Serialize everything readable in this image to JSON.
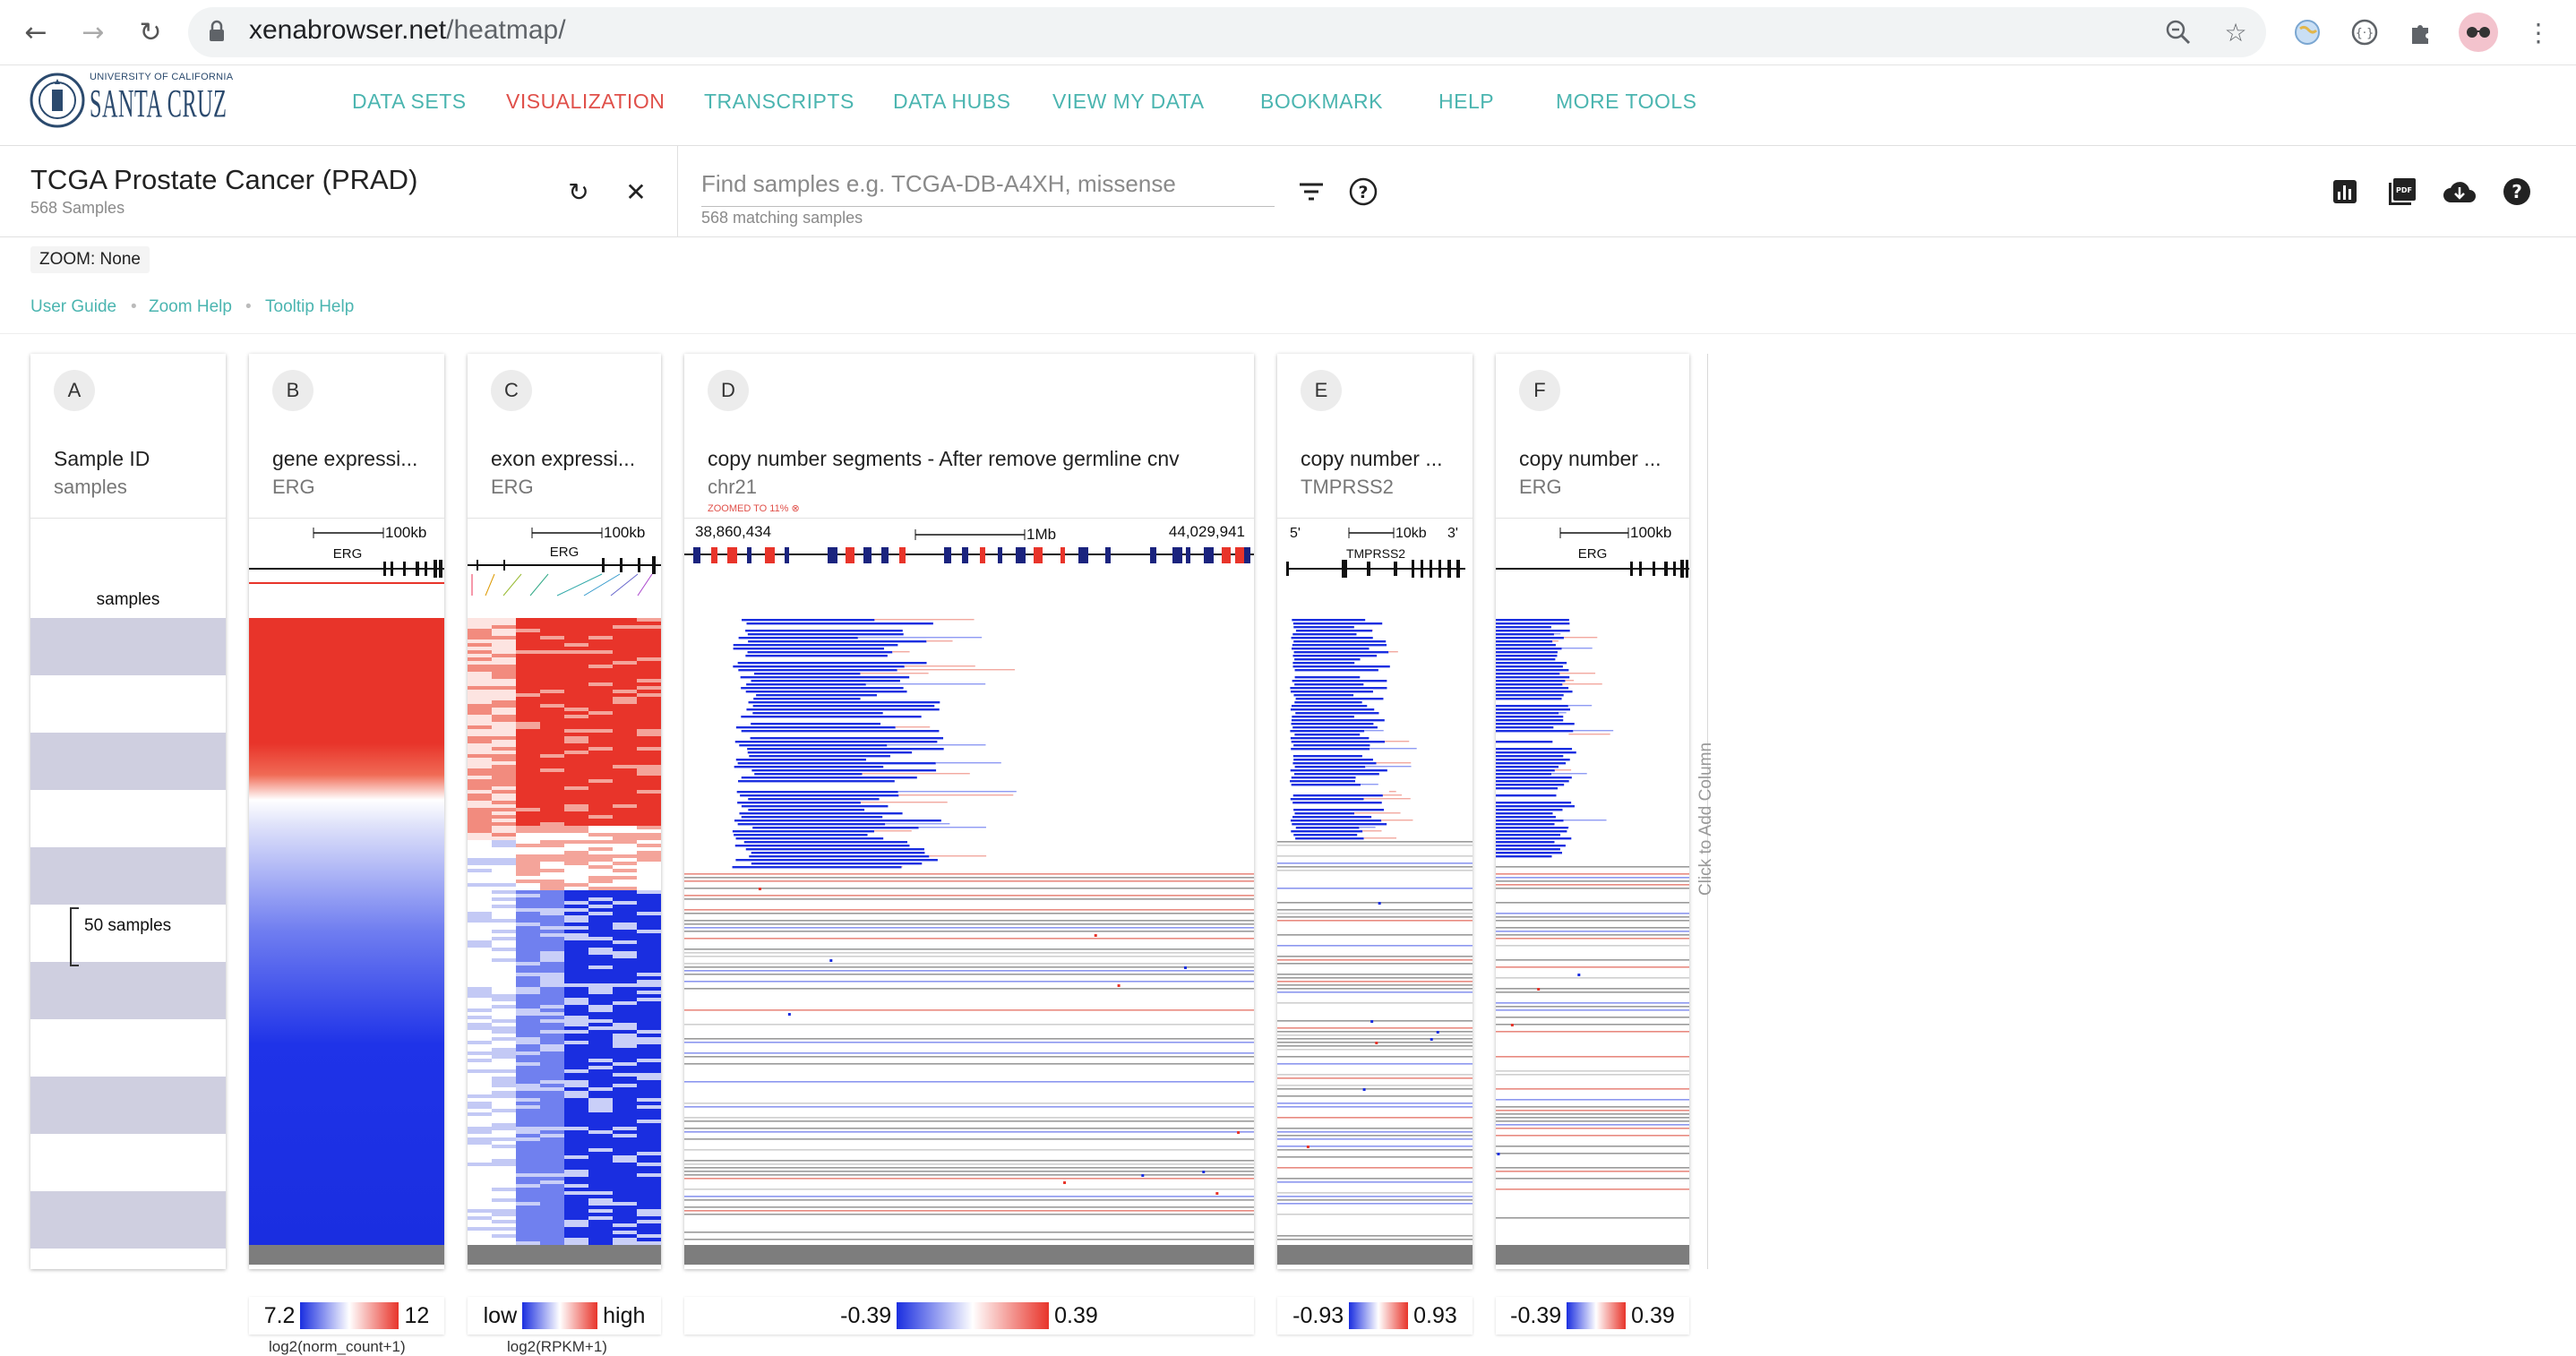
{
  "browser": {
    "url_host": "xenabrowser.net",
    "url_path": "/heatmap/",
    "icons": [
      "back-icon",
      "forward-icon",
      "reload-icon",
      "lock-icon",
      "zoom-icon",
      "star-icon",
      "extension-icon",
      "profile-avatar-icon",
      "menu-icon"
    ]
  },
  "site": {
    "logo_top": "UNIVERSITY OF CALIFORNIA",
    "logo_main": "SANTA CRUZ",
    "nav": [
      "DATA SETS",
      "VISUALIZATION",
      "TRANSCRIPTS",
      "DATA HUBS",
      "VIEW MY DATA",
      "BOOKMARK",
      "HELP",
      "MORE TOOLS"
    ],
    "active_nav": "VISUALIZATION",
    "accent": "#4bb5b0",
    "active_color": "#e0504a"
  },
  "cohort": {
    "title": "TCGA Prostate Cancer (PRAD)",
    "count": "568 Samples"
  },
  "search": {
    "placeholder": "Find samples e.g. TCGA-DB-A4XH, missense",
    "matching": "568 matching samples"
  },
  "zoom": "ZOOM: None",
  "help_links": [
    "User Guide",
    "Zoom Help",
    "Tooltip Help"
  ],
  "columns": [
    {
      "letter": "A",
      "title": "Sample ID",
      "subtitle": "samples",
      "axis_label": "samples",
      "bracket_label": "50 samples"
    },
    {
      "letter": "B",
      "title": "gene expressi...",
      "subtitle": "ERG",
      "scale": "100kb",
      "gene": "ERG"
    },
    {
      "letter": "C",
      "title": "exon expressi...",
      "subtitle": "ERG",
      "scale": "100kb",
      "gene": "ERG"
    },
    {
      "letter": "D",
      "title": "copy number segments - After remove germline cnv",
      "subtitle": "chr21",
      "zoom_note": "ZOOMED TO 11%",
      "pos_start": "38,860,434",
      "pos_end": "44,029,941",
      "scale": "1Mb"
    },
    {
      "letter": "E",
      "title": "copy number ...",
      "subtitle": "TMPRSS2",
      "scale": "10kb",
      "gene": "TMPRSS2",
      "five_prime": "5'",
      "three_prime": "3'"
    },
    {
      "letter": "F",
      "title": "copy number ...",
      "subtitle": "ERG",
      "scale": "100kb",
      "gene": "ERG"
    }
  ],
  "legends": [
    {
      "min": "7.2",
      "max": "12",
      "caption": "log2(norm_count+1)"
    },
    {
      "min": "low",
      "max": "high",
      "caption": "log2(RPKM+1)"
    },
    {
      "min": "-0.39",
      "max": "0.39"
    },
    {
      "min": "-0.93",
      "max": "0.93"
    },
    {
      "min": "-0.39",
      "max": "0.39"
    }
  ],
  "add_column": "Click to Add Column",
  "colors": {
    "red": "#e8342a",
    "blue": "#1a2ee0",
    "band": "#cfcfe0"
  }
}
